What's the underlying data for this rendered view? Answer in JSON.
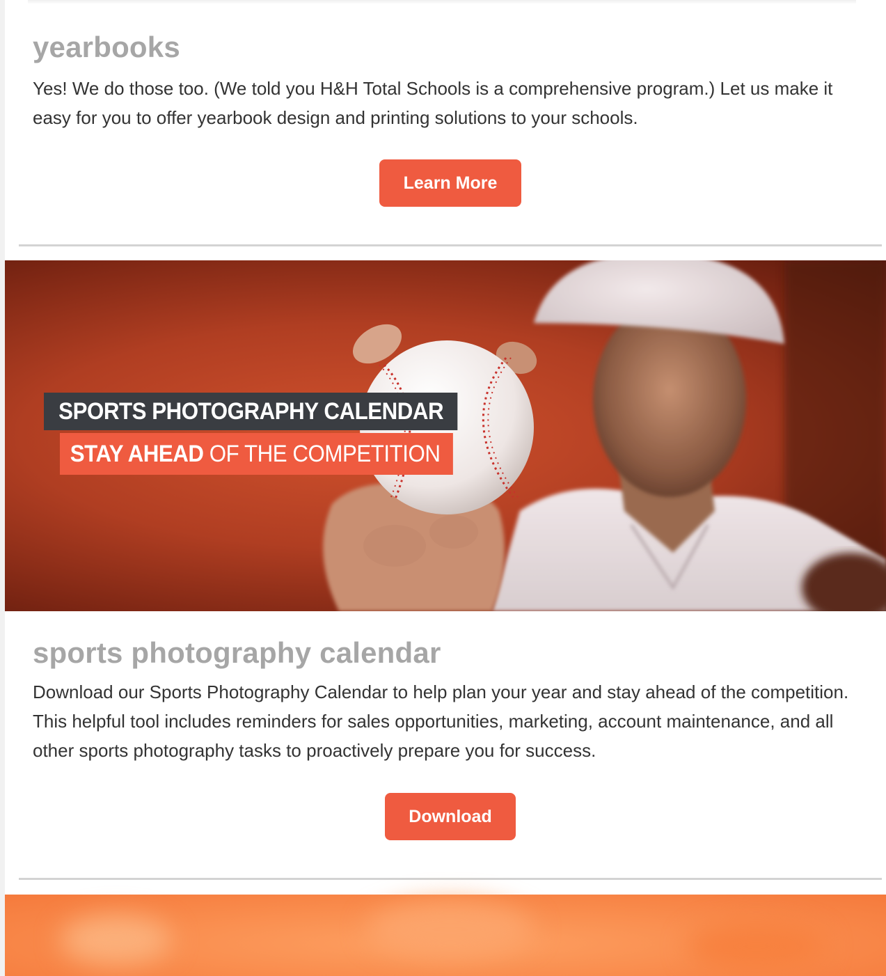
{
  "yearbooks": {
    "title": "yearbooks",
    "body": "Yes! We do those too. (We told you H&H Total Schools is a comprehensive program.) Let us make it easy for you to offer yearbook design and printing solutions to your schools.",
    "button_label": "Learn More"
  },
  "sports_banner": {
    "line1": "SPORTS PHOTOGRAPHY CALENDAR",
    "line2_strong": "STAY AHEAD",
    "line2_rest": "OF THE COMPETITION"
  },
  "sports_calendar": {
    "title": "sports photography calendar",
    "body": "Download our Sports Photography Calendar to help plan your year and stay ahead of the competition. This helpful tool includes reminders for sales opportunities, marketing, account maintenance, and all other sports photography tasks to proactively prepare you for success.",
    "button_label": "Download"
  },
  "colors": {
    "accent": "#ef5b40",
    "heading": "#a6a6a6",
    "body_text": "#333333",
    "banner_label_dark": "#3a3d42"
  }
}
